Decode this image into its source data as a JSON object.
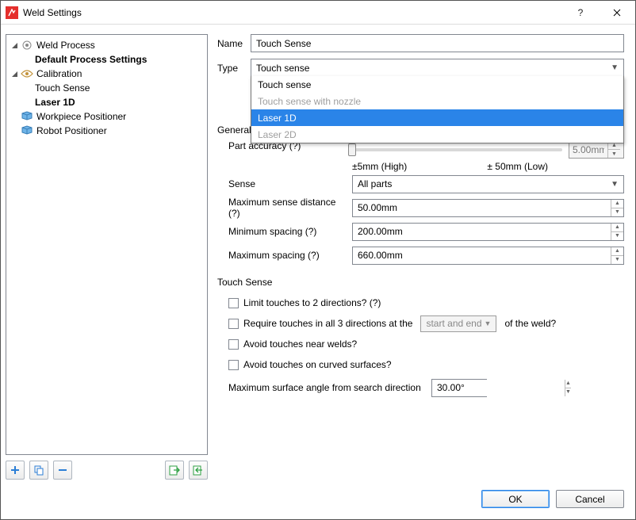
{
  "window": {
    "title": "Weld Settings"
  },
  "tree": {
    "items": [
      {
        "id": "weld-process",
        "label": "Weld Process",
        "depth": 0,
        "twisty": "open",
        "icon": "target-icon",
        "bold": false
      },
      {
        "id": "default-process-settings",
        "label": "Default Process Settings",
        "depth": 1,
        "twisty": "none",
        "icon": "none",
        "bold": true
      },
      {
        "id": "calibration",
        "label": "Calibration",
        "depth": 0,
        "twisty": "open",
        "icon": "eye-icon",
        "bold": false
      },
      {
        "id": "touch-sense",
        "label": "Touch Sense",
        "depth": 1,
        "twisty": "none",
        "icon": "none",
        "bold": false
      },
      {
        "id": "laser-1d",
        "label": "Laser 1D",
        "depth": 1,
        "twisty": "none",
        "icon": "none",
        "bold": true
      },
      {
        "id": "workpiece-positioner",
        "label": "Workpiece Positioner",
        "depth": 0,
        "twisty": "none",
        "icon": "positioner-icon",
        "bold": false
      },
      {
        "id": "robot-positioner",
        "label": "Robot Positioner",
        "depth": 0,
        "twisty": "none",
        "icon": "positioner-icon",
        "bold": false
      }
    ]
  },
  "tree_toolbar": {
    "add": "add",
    "copy": "copy",
    "remove": "remove",
    "import": "import",
    "export": "export"
  },
  "form": {
    "name_label": "Name",
    "name_value": "Touch Sense",
    "type_label": "Type",
    "type_selected": "Touch sense",
    "type_options": [
      {
        "label": "Touch sense",
        "state": "normal"
      },
      {
        "label": "Touch sense with nozzle",
        "state": "disabled"
      },
      {
        "label": "Laser 1D",
        "state": "selected"
      },
      {
        "label": "Laser 2D",
        "state": "disabled"
      }
    ],
    "general_section": "General",
    "part_accuracy_label": "Part accuracy (?)",
    "slider_low": "±5mm (High)",
    "slider_high": "± 50mm (Low)",
    "slider_value": "5.00mm",
    "sense_label": "Sense",
    "sense_value": "All parts",
    "max_sense_dist_label": "Maximum sense distance (?)",
    "max_sense_dist_value": "50.00mm",
    "min_spacing_label": "Minimum spacing (?)",
    "min_spacing_value": "200.00mm",
    "max_spacing_label": "Maximum spacing (?)",
    "max_spacing_value": "660.00mm",
    "touch_section": "Touch Sense",
    "limit_touches_label": "Limit touches to 2 directions? (?)",
    "require_touches_prefix": "Require touches in all 3 directions at the",
    "require_touches_select": "start and end",
    "require_touches_suffix": "of the weld?",
    "avoid_welds_label": "Avoid touches near welds?",
    "avoid_curved_label": "Avoid touches on curved surfaces?",
    "max_surface_angle_label": "Maximum surface angle from search direction",
    "max_surface_angle_value": "30.00°"
  },
  "buttons": {
    "ok": "OK",
    "cancel": "Cancel"
  }
}
